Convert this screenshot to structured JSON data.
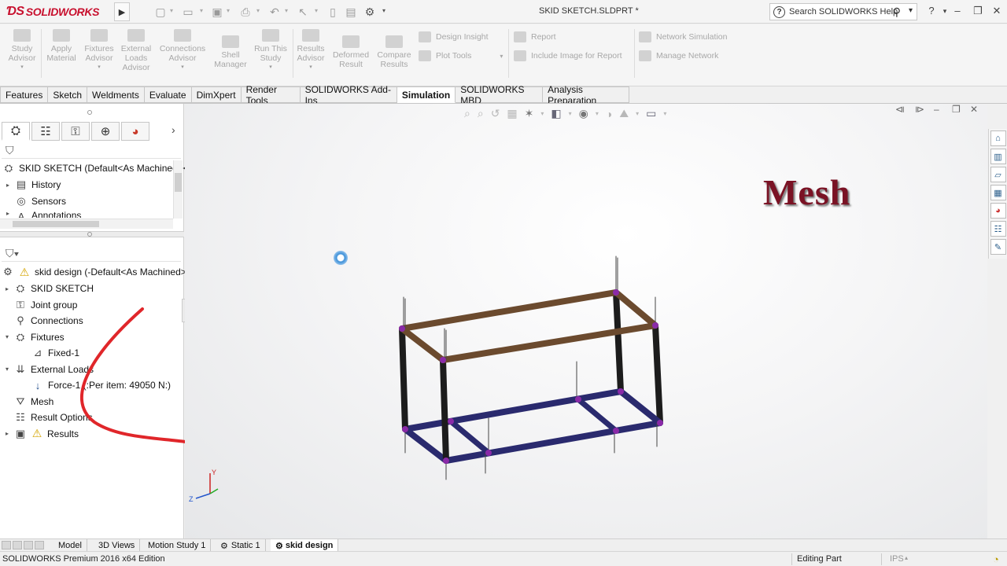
{
  "app": {
    "logo_text": "SOLIDWORKS",
    "document_title": "SKID SKETCH.SLDPRT *",
    "help_search_placeholder": "Search SOLIDWORKS Help",
    "help_dropdown": "?"
  },
  "command_manager": {
    "buttons": [
      {
        "label": "Study\nAdvisor"
      },
      {
        "label": "Apply\nMaterial"
      },
      {
        "label": "Fixtures\nAdvisor"
      },
      {
        "label": "External\nLoads\nAdvisor"
      },
      {
        "label": "Connections\nAdvisor"
      },
      {
        "label": "Shell\nManager"
      },
      {
        "label": "Run This\nStudy"
      },
      {
        "label": "Results\nAdvisor"
      },
      {
        "label": "Deformed\nResult"
      },
      {
        "label": "Compare\nResults"
      }
    ],
    "rows": [
      {
        "label": "Design Insight"
      },
      {
        "label": "Plot Tools"
      },
      {
        "label": "Report"
      },
      {
        "label": "Include Image for Report"
      },
      {
        "label": "Network Simulation"
      },
      {
        "label": "Manage Network"
      }
    ]
  },
  "tabs": [
    {
      "label": "Features"
    },
    {
      "label": "Sketch"
    },
    {
      "label": "Weldments"
    },
    {
      "label": "Evaluate"
    },
    {
      "label": "DimXpert"
    },
    {
      "label": "Render Tools"
    },
    {
      "label": "SOLIDWORKS Add-Ins"
    },
    {
      "label": "Simulation",
      "active": true
    },
    {
      "label": "SOLIDWORKS MBD"
    },
    {
      "label": "Analysis Preparation"
    }
  ],
  "feature_tree": {
    "root": "SKID SKETCH  (Default<As Machined><",
    "items": [
      "History",
      "Sensors",
      "Annotations"
    ]
  },
  "study_tree": {
    "root": "skid design (-Default<As Machined>-",
    "items": [
      {
        "label": "SKID SKETCH",
        "level": 1,
        "expander": "▸"
      },
      {
        "label": "Joint group",
        "level": 1,
        "expander": ""
      },
      {
        "label": "Connections",
        "level": 1,
        "expander": ""
      },
      {
        "label": "Fixtures",
        "level": 1,
        "expander": "▾"
      },
      {
        "label": "Fixed-1",
        "level": 2,
        "expander": ""
      },
      {
        "label": "External Loads",
        "level": 1,
        "expander": "▾"
      },
      {
        "label": "Force-1 (:Per item: 49050 N:)",
        "level": 2,
        "expander": ""
      },
      {
        "label": "Mesh",
        "level": 1,
        "expander": ""
      },
      {
        "label": "Result Options",
        "level": 1,
        "expander": ""
      },
      {
        "label": "Results",
        "level": 1,
        "expander": "▸"
      }
    ]
  },
  "graphics": {
    "overlay_title": "Mesh",
    "triad_axes": {
      "y": "Y",
      "z": "Z"
    }
  },
  "bottom_tabs": [
    {
      "label": "Model"
    },
    {
      "label": "3D Views"
    },
    {
      "label": "Motion Study 1"
    },
    {
      "label": "Static 1"
    },
    {
      "label": "skid design",
      "active": true
    }
  ],
  "status": {
    "edition": "SOLIDWORKS Premium 2016 x64 Edition",
    "mode": "Editing Part",
    "units": "IPS"
  },
  "colors": {
    "brand_red": "#c8102e",
    "mesh_title": "#7a1224",
    "frame_top_beams": "#6b4a2e",
    "frame_bottom_beams": "#2a2a6e",
    "frame_posts": "#1c1c1c",
    "annotation_arrow": "#e0262a"
  }
}
